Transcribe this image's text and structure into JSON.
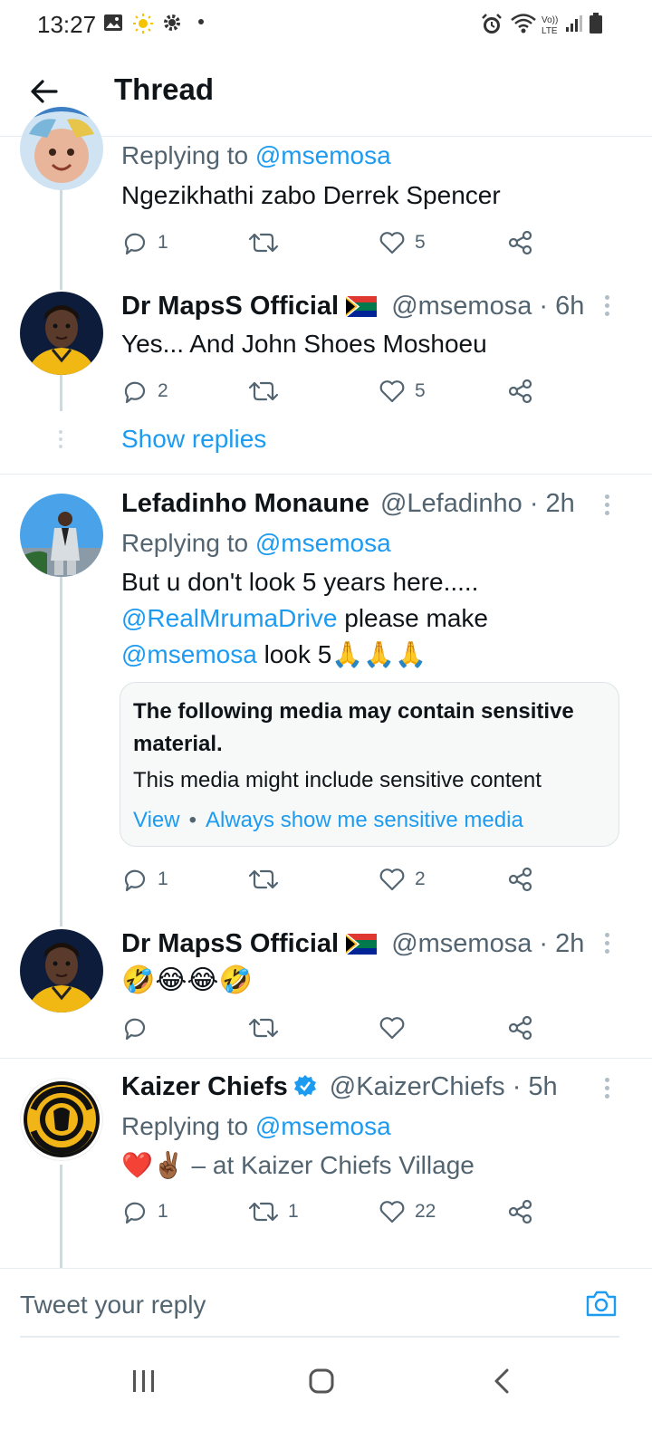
{
  "status_bar": {
    "time": "13:27"
  },
  "header": {
    "title": "Thread"
  },
  "tweets": [
    {
      "replying_prefix": "Replying to ",
      "replying_to": "@msemosa",
      "text": "Ngezikhathi zabo Derrek Spencer",
      "reply_count": "1",
      "retweet_count": "",
      "like_count": "5"
    },
    {
      "name": "Dr MapsS Official",
      "handle": "@msemosa",
      "time": "· 6h",
      "text": "Yes... And John Shoes Moshoeu",
      "reply_count": "2",
      "retweet_count": "",
      "like_count": "5",
      "show_replies": "Show replies"
    },
    {
      "name": "Lefadinho Monaune",
      "handle": "@Lefadinho",
      "time": "· 2h",
      "replying_prefix": "Replying to ",
      "replying_to": "@msemosa",
      "text_line1": "But u don't look 5 years here.....",
      "mention1": "@RealMrumaDrive",
      "text_line2": " please make",
      "mention2": "@msemosa",
      "text_line3": " look 5",
      "emojis": "🙏🙏🙏",
      "sensitive": {
        "title": "The following media may contain sensitive material.",
        "description": "This media might include sensitive content",
        "view": "View",
        "separator": "•",
        "always_show": "Always show me sensitive media"
      },
      "reply_count": "1",
      "retweet_count": "",
      "like_count": "2"
    },
    {
      "name": "Dr MapsS Official",
      "handle": "@msemosa",
      "time": "· 2h",
      "emojis": "🤣😂😂🤣",
      "reply_count": "",
      "retweet_count": "",
      "like_count": ""
    },
    {
      "name": "Kaizer Chiefs",
      "handle": "@KaizerChiefs",
      "time": "· 5h",
      "replying_prefix": "Replying to ",
      "replying_to": "@msemosa",
      "emojis": "❤️✌🏾",
      "text": " – at Kaizer Chiefs Village",
      "reply_count": "1",
      "retweet_count": "1",
      "like_count": "22"
    }
  ],
  "reply_bar": {
    "placeholder": "Tweet your reply"
  },
  "icons": {
    "back": "arrow-left-icon",
    "reply": "comment-icon",
    "retweet": "retweet-icon",
    "like": "heart-icon",
    "share": "share-icon",
    "camera": "camera-icon"
  },
  "colors": {
    "accent": "#1d9bf0",
    "text": "#0f1419",
    "secondary": "#536471"
  }
}
